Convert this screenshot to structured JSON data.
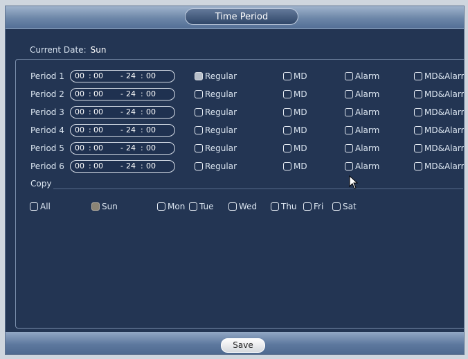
{
  "window": {
    "title": "Time Period"
  },
  "current_date": {
    "label": "Current Date:",
    "value": "Sun"
  },
  "periods": [
    {
      "label": "Period 1",
      "start_h": "00",
      "start_m": "00",
      "end_h": "24",
      "end_m": "00",
      "regular_checked": true
    },
    {
      "label": "Period 2",
      "start_h": "00",
      "start_m": "00",
      "end_h": "24",
      "end_m": "00",
      "regular_checked": false
    },
    {
      "label": "Period 3",
      "start_h": "00",
      "start_m": "00",
      "end_h": "24",
      "end_m": "00",
      "regular_checked": false
    },
    {
      "label": "Period 4",
      "start_h": "00",
      "start_m": "00",
      "end_h": "24",
      "end_m": "00",
      "regular_checked": false
    },
    {
      "label": "Period 5",
      "start_h": "00",
      "start_m": "00",
      "end_h": "24",
      "end_m": "00",
      "regular_checked": false
    },
    {
      "label": "Period 6",
      "start_h": "00",
      "start_m": "00",
      "end_h": "24",
      "end_m": "00",
      "regular_checked": false
    }
  ],
  "options": {
    "regular": "Regular",
    "md": "MD",
    "alarm": "Alarm",
    "md_alarm": "MD&Alarm"
  },
  "time_sep": ":",
  "range_sep": "-",
  "copy": {
    "label": "Copy",
    "all": "All",
    "days": [
      "Sun",
      "Mon",
      "Tue",
      "Wed",
      "Thu",
      "Fri",
      "Sat"
    ],
    "checked_day": "Sun"
  },
  "footer": {
    "save_label": "Save"
  }
}
